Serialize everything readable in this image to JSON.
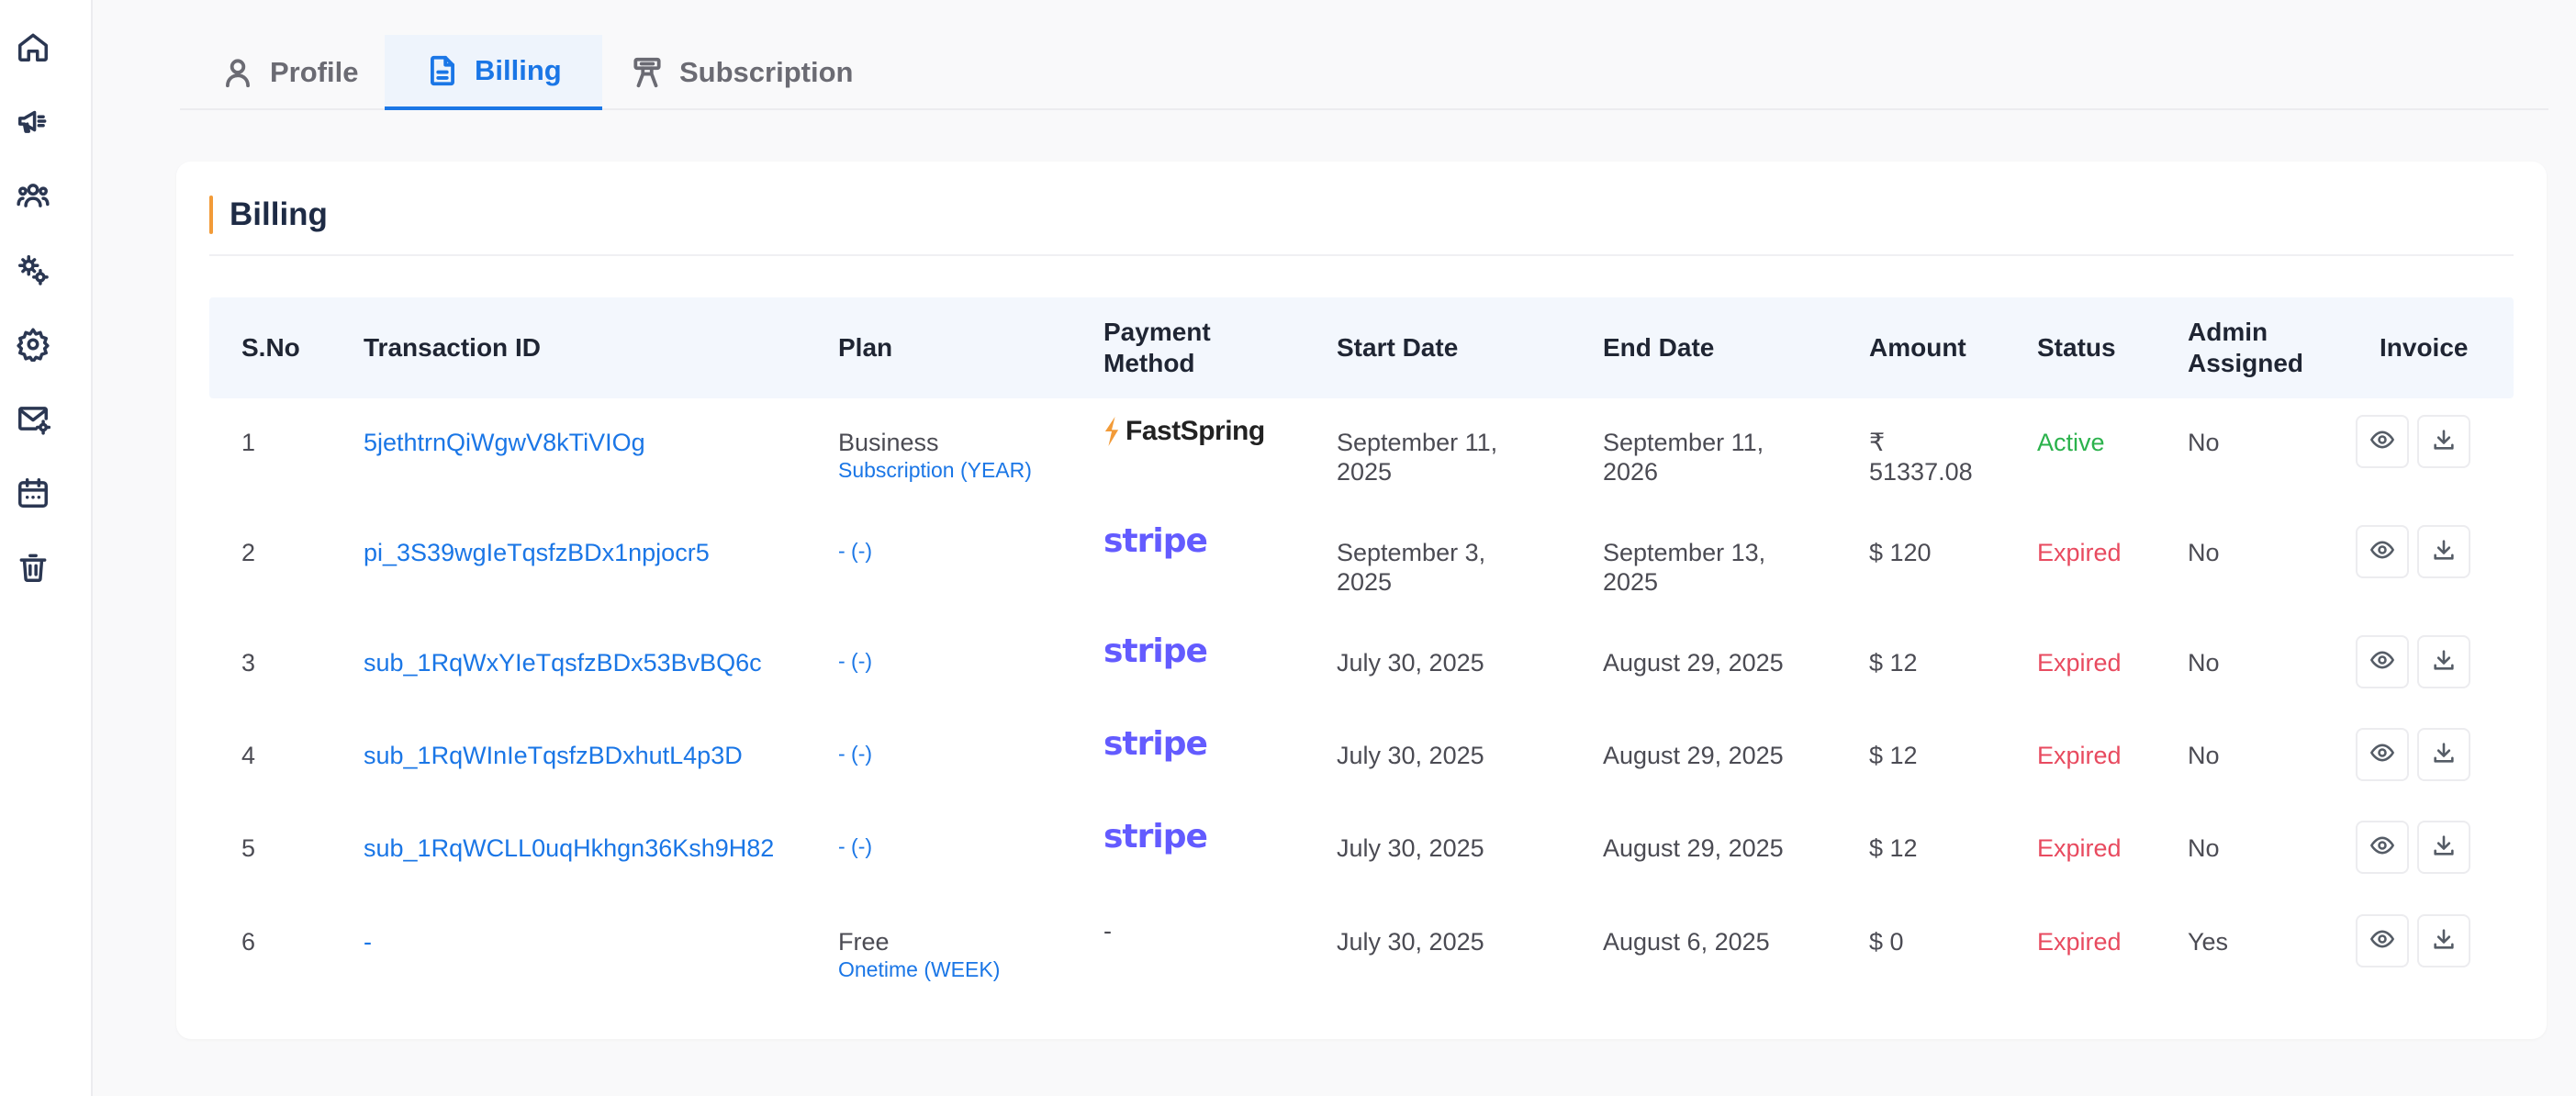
{
  "sidebar": {
    "items": [
      {
        "icon": "home-icon"
      },
      {
        "icon": "megaphone-icon"
      },
      {
        "icon": "users-icon"
      },
      {
        "icon": "gears-icon"
      },
      {
        "icon": "settings-icon"
      },
      {
        "icon": "mail-settings-icon"
      },
      {
        "icon": "calendar-icon"
      },
      {
        "icon": "trash-icon"
      }
    ]
  },
  "tabs": [
    {
      "label": "Profile",
      "icon": "user-icon",
      "active": false
    },
    {
      "label": "Billing",
      "icon": "document-icon",
      "active": true
    },
    {
      "label": "Subscription",
      "icon": "subscription-icon",
      "active": false
    }
  ],
  "card": {
    "title": "Billing",
    "accent_color": "#f29b38"
  },
  "table": {
    "headers": {
      "sno": "S.No",
      "transaction_id": "Transaction ID",
      "plan": "Plan",
      "payment_method_1": "Payment",
      "payment_method_2": "Method",
      "start_date": "Start Date",
      "end_date": "End Date",
      "amount": "Amount",
      "status": "Status",
      "admin_assigned_1": "Admin",
      "admin_assigned_2": "Assigned",
      "invoice": "Invoice"
    },
    "rows": [
      {
        "sno": "1",
        "transaction_id": "5jethtrnQiWgwV8kTiVIOg",
        "plan": "Business",
        "plan_sub": "Subscription (YEAR)",
        "payment": "FastSpring",
        "start_1": "September 11,",
        "start_2": "2025",
        "end_1": "September 11,",
        "end_2": "2026",
        "amount_1": "₹",
        "amount_2": "51337.08",
        "status": "Active",
        "admin": "No"
      },
      {
        "sno": "2",
        "transaction_id": "pi_3S39wgIeTqsfzBDx1npjocr5",
        "plan": "",
        "plan_sub": "- (-)",
        "payment": "stripe",
        "start_1": "September 3,",
        "start_2": "2025",
        "end_1": "September 13,",
        "end_2": "2025",
        "amount_1": "$ 120",
        "amount_2": "",
        "status": "Expired",
        "admin": "No"
      },
      {
        "sno": "3",
        "transaction_id": "sub_1RqWxYIeTqsfzBDx53BvBQ6c",
        "plan": "",
        "plan_sub": "- (-)",
        "payment": "stripe",
        "start_1": "July 30, 2025",
        "start_2": "",
        "end_1": "August 29, 2025",
        "end_2": "",
        "amount_1": "$ 12",
        "amount_2": "",
        "status": "Expired",
        "admin": "No"
      },
      {
        "sno": "4",
        "transaction_id": "sub_1RqWInIeTqsfzBDxhutL4p3D",
        "plan": "",
        "plan_sub": "- (-)",
        "payment": "stripe",
        "start_1": "July 30, 2025",
        "start_2": "",
        "end_1": "August 29, 2025",
        "end_2": "",
        "amount_1": "$ 12",
        "amount_2": "",
        "status": "Expired",
        "admin": "No"
      },
      {
        "sno": "5",
        "transaction_id": "sub_1RqWCLL0uqHkhgn36Ksh9H82",
        "plan": "",
        "plan_sub": "- (-)",
        "payment": "stripe",
        "start_1": "July 30, 2025",
        "start_2": "",
        "end_1": "August 29, 2025",
        "end_2": "",
        "amount_1": "$ 12",
        "amount_2": "",
        "status": "Expired",
        "admin": "No"
      },
      {
        "sno": "6",
        "transaction_id": "-",
        "plan": "Free",
        "plan_sub": "Onetime (WEEK)",
        "payment": "-",
        "start_1": "July 30, 2025",
        "start_2": "",
        "end_1": "August 6, 2025",
        "end_2": "",
        "amount_1": "$ 0",
        "amount_2": "",
        "status": "Expired",
        "admin": "Yes"
      }
    ]
  },
  "colors": {
    "link": "#1a76e6",
    "active_status": "#2bb24c",
    "expired_status": "#e84a5f",
    "stripe": "#635bff"
  }
}
